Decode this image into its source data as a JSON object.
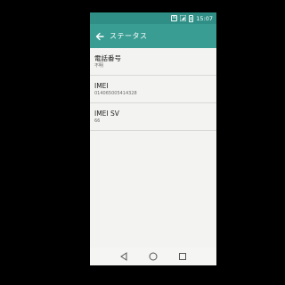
{
  "status_bar": {
    "time": "15:07",
    "icons": [
      "nfc-icon",
      "signal-icon",
      "battery-icon"
    ]
  },
  "app_bar": {
    "title": "ステータス",
    "back_icon": "back-arrow-icon"
  },
  "items": [
    {
      "title": "電話番号",
      "value": "不明"
    },
    {
      "title": "IMEI",
      "value": "014065005414328"
    },
    {
      "title": "IMEI SV",
      "value": "66"
    }
  ],
  "nav_bar": {
    "buttons": [
      "back-triangle-icon",
      "home-circle-icon",
      "recents-square-icon"
    ]
  },
  "colors": {
    "status_bar": "#2f8f86",
    "app_bar": "#3a9d93",
    "background": "#f3f3f1"
  }
}
